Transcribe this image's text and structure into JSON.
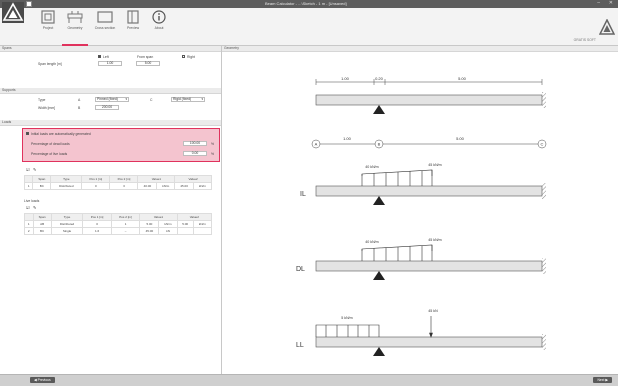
{
  "window": {
    "title": "Beam Calculator - ...\\Sketch - 1 m - [Unsaved]",
    "min": "–",
    "close": "✕"
  },
  "ribbon": {
    "tabs": [
      {
        "label": "Project"
      },
      {
        "label": "Geometry"
      },
      {
        "label": "Cross section"
      },
      {
        "label": "Preview"
      },
      {
        "label": "About"
      }
    ],
    "brand_text": "GRATIS SOFT"
  },
  "left": {
    "span": {
      "section": "Spans",
      "left_label": "Left",
      "from_span_label": "From span",
      "right_label": "Right",
      "length_label": "Span length [m]",
      "left_value": "1.00",
      "right_value": "5.00"
    },
    "supports": {
      "section": "Supports",
      "type_label": "Type",
      "a_label": "A",
      "a_value": "Pinned (fixed)",
      "c_label": "C",
      "c_value": "Rigid (fixed)",
      "width_label": "Width [mm]",
      "b_label": "B",
      "width_value": "200.00"
    },
    "loads": {
      "section": "Loads",
      "auto_label": "Initial loads are automatically generated",
      "dead_label": "Percentage of dead loads",
      "dead_value": "100.00",
      "dead_unit": "%",
      "live_label": "Percentage of live loads",
      "live_value": "0.00",
      "live_unit": "%"
    },
    "dead_table": {
      "headers": [
        "Span",
        "Type",
        "Pos 1 [m]",
        "Pos 2 [m]",
        "Value1",
        "Value2"
      ],
      "rows": [
        {
          "idx": "1",
          "span": "BC",
          "type": "Distributed",
          "p1": "0",
          "p2": "3",
          "v1": "40.00",
          "u1": "kN/m",
          "v2": "45.00",
          "u2": "kN/m"
        }
      ]
    },
    "live_section": "Live loads",
    "live_table": {
      "headers": [
        "Span",
        "Type",
        "Pos 1 [m]",
        "Pos 2 [m]",
        "Value1",
        "Value2"
      ],
      "rows": [
        {
          "idx": "1",
          "span": "AB",
          "type": "Distributed",
          "p1": "0",
          "p2": "1",
          "v1": "5.00",
          "u1": "kN/m",
          "v2": "5.00",
          "u2": "kN/m"
        },
        {
          "idx": "2",
          "span": "BC",
          "type": "Single",
          "p1": "1.6",
          "p2": "–",
          "v1": "45.00",
          "u1": "kN",
          "v2": "",
          "u2": ""
        }
      ]
    }
  },
  "right": {
    "header": "Geometry",
    "dims": [
      "1.00",
      "0.20",
      "5.00"
    ],
    "nodes": [
      "A",
      "B",
      "C"
    ],
    "node_dims": [
      "1.00",
      "5.00"
    ],
    "diagrams": [
      {
        "label": "IL",
        "load1": "40 kN/m",
        "load2": "45 kN/m"
      },
      {
        "label": "DL",
        "load1": "40 kN/m",
        "load2": "45 kN/m"
      },
      {
        "label": "LL",
        "load1": "5 kN/m",
        "load2": "45 kN"
      }
    ]
  },
  "status": {
    "prev": "Previous",
    "next": "Next"
  }
}
